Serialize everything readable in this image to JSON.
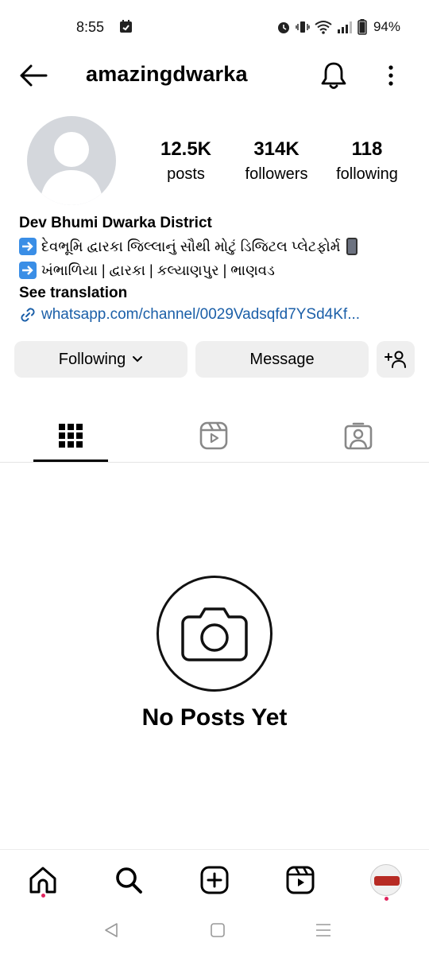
{
  "status_bar": {
    "time": "8:55",
    "battery_percent": "94%",
    "icons": [
      "calendar-app-icon",
      "alarm-icon",
      "vibrate-icon",
      "wifi-icon",
      "signal-icon",
      "battery-icon"
    ]
  },
  "header": {
    "username": "amazingdwarka",
    "icons": [
      "back-arrow-icon",
      "bell-icon",
      "more-vertical-icon"
    ]
  },
  "profile": {
    "stats": [
      {
        "value": "12.5K",
        "label": "posts"
      },
      {
        "value": "314K",
        "label": "followers"
      },
      {
        "value": "118",
        "label": "following"
      }
    ],
    "bio": {
      "name": "Dev Bhumi Dwarka District",
      "line1": "દેવભૂમિ દ્વારકા જિલ્લાનું સૌથી મોટું ડિજિટલ પ્લેટફોર્મ",
      "line2": "ખંભાળિયા | દ્વારકા | કલ્યાણપુર | ભાણવડ",
      "see_translation": "See translation",
      "link": "whatsapp.com/channel/0029Vadsqfd7YSd4Kf..."
    }
  },
  "actions": {
    "following_label": "Following",
    "message_label": "Message"
  },
  "tabs": [
    {
      "name": "grid",
      "icon": "grid-icon",
      "active": true
    },
    {
      "name": "reels",
      "icon": "reels-icon",
      "active": false
    },
    {
      "name": "tagged",
      "icon": "tagged-person-icon",
      "active": false
    }
  ],
  "empty_state": {
    "title": "No Posts Yet",
    "icon": "camera-icon"
  },
  "bottom_nav": {
    "items": [
      "home-icon",
      "search-icon",
      "create-icon",
      "reels-icon",
      "profile-avatar"
    ]
  },
  "colors": {
    "link": "#1b5fa8",
    "button_bg": "#efefef",
    "notification_dot": "#e0245e",
    "avatar_bg": "#d4d7dc"
  }
}
